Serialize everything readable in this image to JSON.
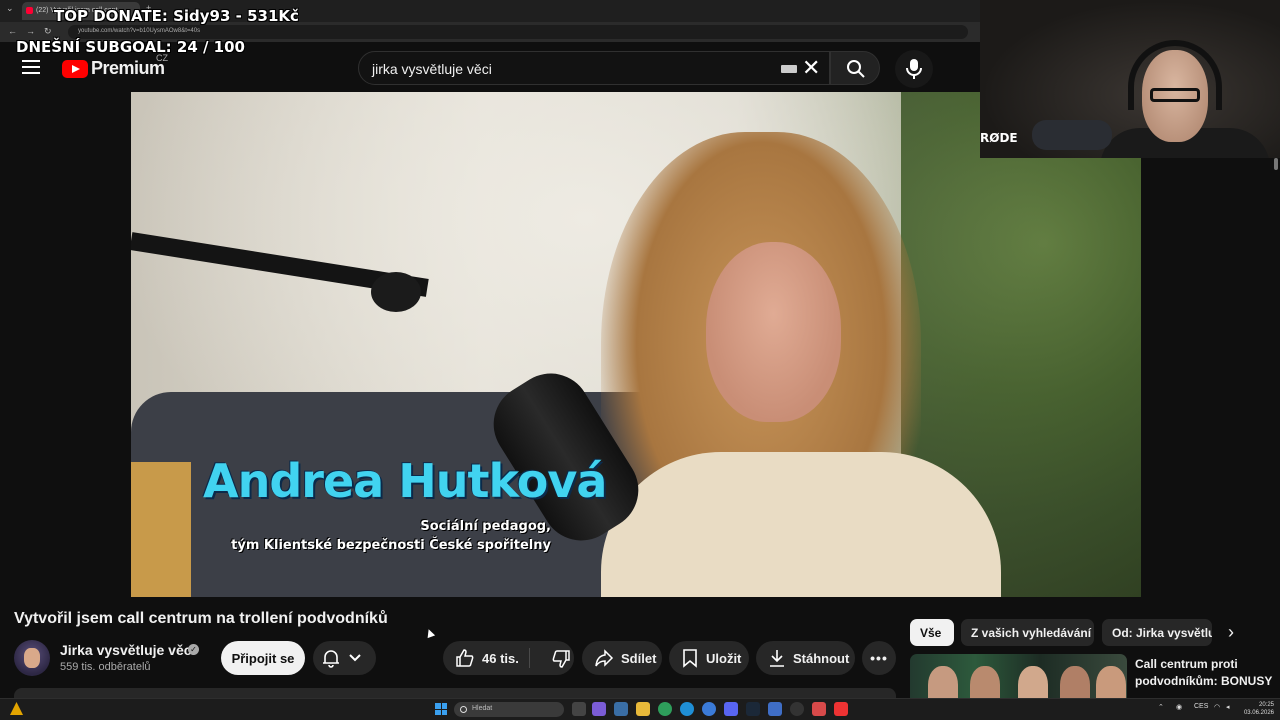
{
  "browser": {
    "tab_title": "(22) Vytvořil jsem call cent…",
    "url": "youtube.com/watch?v=b10UysmAOw8&t=40s"
  },
  "stream_overlay": {
    "top_donate": "TOP DONATE: Sidy93 - 531Kč",
    "subgoal": "DNEŠNÍ SUBGOAL: 24 / 100",
    "webcam_brand": "RØDE"
  },
  "masthead": {
    "logo_text": "Premium",
    "country_code": "CZ",
    "search_value": "jirka vysvětluje věci"
  },
  "video": {
    "lower_third_name": "Andrea Hutková",
    "lower_third_role_line1": "Sociální pedagog,",
    "lower_third_role_line2": "tým Klientské bezpečnosti České spořitelny",
    "title": "Vytvořil jsem call centrum na trollení podvodníků"
  },
  "channel": {
    "name": "Jirka vysvětluje věci",
    "subscribers": "559 tis. odběratelů",
    "join_label": "Připojit se"
  },
  "actions": {
    "likes": "46 tis.",
    "share_label": "Sdílet",
    "save_label": "Uložit",
    "download_label": "Stáhnout",
    "more_label": "•••"
  },
  "sidebar": {
    "chips": [
      "Vše",
      "Z vašich vyhledávání",
      "Od: Jirka vysvětluje věci"
    ],
    "rec_title": "Call centrum proti podvodníkům: BONUSY"
  },
  "taskbar": {
    "search_placeholder": "Hledat",
    "lang": "CES",
    "time": "20:25",
    "date": "03.06.2026"
  },
  "colors": {
    "youtube_red": "#ff0000",
    "background": "#0f0f0f",
    "lower_third_name": "#41d3f0"
  }
}
